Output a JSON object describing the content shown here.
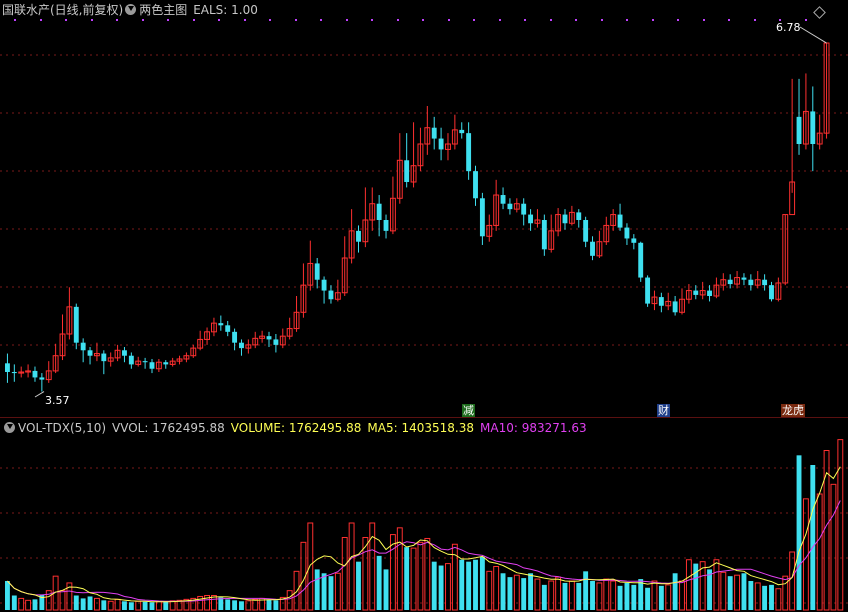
{
  "header": {
    "stock_name": "国联水产(日线,前复权)",
    "indicator_name": "两色主图",
    "eals_label": "EALS: 1.00"
  },
  "price_chart": {
    "high_label": "6.78",
    "low_label": "3.57",
    "tags": [
      {
        "text": "减",
        "bg": "#1d6b1d"
      },
      {
        "text": "财",
        "bg": "#1f3f8a"
      },
      {
        "text": "龙虎",
        "bg": "#7a2a10"
      }
    ]
  },
  "volume_panel": {
    "title": "VOL-TDX(5,10)",
    "vvol": "VVOL: 1762495.88",
    "volume": "VOLUME: 1762495.88",
    "ma5": "MA5: 1403518.38",
    "ma10": "MA10: 983271.63"
  },
  "colors": {
    "up": "#ff3030",
    "down": "#3fe0f0",
    "grid": "#7a1a1a",
    "text": "#c8c8c8",
    "ma5": "#ffff55",
    "ma10": "#e040f0",
    "marker": "#c040ff"
  },
  "chart_data": {
    "type": "candlestick",
    "ylim": [
      3.4,
      6.9
    ],
    "high": 6.78,
    "low": 3.57,
    "candles": [
      [
        3.83,
        3.75,
        3.92,
        3.65
      ],
      [
        3.75,
        3.74,
        3.82,
        3.66
      ],
      [
        3.74,
        3.75,
        3.8,
        3.7
      ],
      [
        3.75,
        3.76,
        3.82,
        3.7
      ],
      [
        3.76,
        3.7,
        3.8,
        3.66
      ],
      [
        3.7,
        3.68,
        3.74,
        3.57
      ],
      [
        3.68,
        3.76,
        3.85,
        3.65
      ],
      [
        3.76,
        3.9,
        4.01,
        3.74
      ],
      [
        3.9,
        4.1,
        4.28,
        3.86
      ],
      [
        4.1,
        4.35,
        4.53,
        4.05
      ],
      [
        4.35,
        4.02,
        4.38,
        3.96
      ],
      [
        4.02,
        3.95,
        4.06,
        3.84
      ],
      [
        3.95,
        3.9,
        3.98,
        3.82
      ],
      [
        3.9,
        3.92,
        4.02,
        3.85
      ],
      [
        3.92,
        3.85,
        3.95,
        3.73
      ],
      [
        3.85,
        3.88,
        3.93,
        3.8
      ],
      [
        3.88,
        3.95,
        4.0,
        3.85
      ],
      [
        3.95,
        3.9,
        3.98,
        3.84
      ],
      [
        3.9,
        3.82,
        3.93,
        3.78
      ],
      [
        3.82,
        3.85,
        3.89,
        3.8
      ],
      [
        3.85,
        3.84,
        3.88,
        3.78
      ],
      [
        3.84,
        3.78,
        3.87,
        3.74
      ],
      [
        3.78,
        3.84,
        3.87,
        3.75
      ],
      [
        3.84,
        3.82,
        3.86,
        3.78
      ],
      [
        3.82,
        3.85,
        3.88,
        3.8
      ],
      [
        3.85,
        3.87,
        3.9,
        3.82
      ],
      [
        3.87,
        3.9,
        3.93,
        3.84
      ],
      [
        3.9,
        3.97,
        4.0,
        3.88
      ],
      [
        3.97,
        4.05,
        4.13,
        3.95
      ],
      [
        4.05,
        4.12,
        4.16,
        4.0
      ],
      [
        4.12,
        4.2,
        4.25,
        4.08
      ],
      [
        4.2,
        4.18,
        4.27,
        4.13
      ],
      [
        4.18,
        4.12,
        4.22,
        4.08
      ],
      [
        4.12,
        4.02,
        4.15,
        3.95
      ],
      [
        4.02,
        3.97,
        4.05,
        3.9
      ],
      [
        3.97,
        4.0,
        4.05,
        3.92
      ],
      [
        4.0,
        4.06,
        4.12,
        3.97
      ],
      [
        4.06,
        4.08,
        4.13,
        4.02
      ],
      [
        4.08,
        4.05,
        4.12,
        3.98
      ],
      [
        4.05,
        4.0,
        4.1,
        3.93
      ],
      [
        4.0,
        4.08,
        4.15,
        3.97
      ],
      [
        4.08,
        4.15,
        4.25,
        4.05
      ],
      [
        4.15,
        4.3,
        4.45,
        4.12
      ],
      [
        4.3,
        4.55,
        4.75,
        4.25
      ],
      [
        4.55,
        4.75,
        4.96,
        4.5
      ],
      [
        4.75,
        4.6,
        4.8,
        4.52
      ],
      [
        4.6,
        4.5,
        4.63,
        4.38
      ],
      [
        4.5,
        4.42,
        4.55,
        4.38
      ],
      [
        4.42,
        4.48,
        4.6,
        4.4
      ],
      [
        4.48,
        4.8,
        5.0,
        4.45
      ],
      [
        4.8,
        5.05,
        5.25,
        4.75
      ],
      [
        5.05,
        4.95,
        5.1,
        4.85
      ],
      [
        4.95,
        5.15,
        5.45,
        4.9
      ],
      [
        5.15,
        5.3,
        5.45,
        5.05
      ],
      [
        5.3,
        5.15,
        5.38,
        5.0
      ],
      [
        5.15,
        5.05,
        5.2,
        4.98
      ],
      [
        5.05,
        5.35,
        5.55,
        5.02
      ],
      [
        5.35,
        5.7,
        5.95,
        5.3
      ],
      [
        5.7,
        5.5,
        5.95,
        5.45
      ],
      [
        5.5,
        5.65,
        6.05,
        5.45
      ],
      [
        5.65,
        5.85,
        6.0,
        5.6
      ],
      [
        5.85,
        6.0,
        6.2,
        5.75
      ],
      [
        6.0,
        5.9,
        6.1,
        5.8
      ],
      [
        5.9,
        5.8,
        6.0,
        5.7
      ],
      [
        5.8,
        5.85,
        5.95,
        5.7
      ],
      [
        5.85,
        5.98,
        6.12,
        5.8
      ],
      [
        5.98,
        5.95,
        6.05,
        5.9
      ],
      [
        5.95,
        5.6,
        6.05,
        5.52
      ],
      [
        5.6,
        5.35,
        5.65,
        5.28
      ],
      [
        5.35,
        5.0,
        5.4,
        4.92
      ],
      [
        5.0,
        5.1,
        5.2,
        4.95
      ],
      [
        5.1,
        5.38,
        5.52,
        5.05
      ],
      [
        5.38,
        5.3,
        5.45,
        5.25
      ],
      [
        5.3,
        5.25,
        5.35,
        5.2
      ],
      [
        5.25,
        5.3,
        5.35,
        5.22
      ],
      [
        5.3,
        5.2,
        5.35,
        5.1
      ],
      [
        5.2,
        5.12,
        5.25,
        5.05
      ],
      [
        5.12,
        5.15,
        5.25,
        5.08
      ],
      [
        5.15,
        4.88,
        5.2,
        4.82
      ],
      [
        4.88,
        5.05,
        5.2,
        4.85
      ],
      [
        5.05,
        5.2,
        5.26,
        5.0
      ],
      [
        5.2,
        5.12,
        5.25,
        5.06
      ],
      [
        5.12,
        5.22,
        5.28,
        5.1
      ],
      [
        5.22,
        5.15,
        5.25,
        5.08
      ],
      [
        5.15,
        4.95,
        5.18,
        4.9
      ],
      [
        4.95,
        4.82,
        5.0,
        4.78
      ],
      [
        4.82,
        4.95,
        5.05,
        4.8
      ],
      [
        4.95,
        5.1,
        5.18,
        4.92
      ],
      [
        5.1,
        5.2,
        5.25,
        5.05
      ],
      [
        5.2,
        5.08,
        5.3,
        5.05
      ],
      [
        5.08,
        4.98,
        5.12,
        4.92
      ],
      [
        4.98,
        4.94,
        5.02,
        4.88
      ],
      [
        4.94,
        4.62,
        4.95,
        4.58
      ],
      [
        4.62,
        4.38,
        4.64,
        4.35
      ],
      [
        4.38,
        4.44,
        4.5,
        4.32
      ],
      [
        4.44,
        4.36,
        4.48,
        4.3
      ],
      [
        4.36,
        4.4,
        4.48,
        4.32
      ],
      [
        4.4,
        4.3,
        4.45,
        4.27
      ],
      [
        4.3,
        4.42,
        4.52,
        4.28
      ],
      [
        4.42,
        4.5,
        4.56,
        4.38
      ],
      [
        4.5,
        4.46,
        4.55,
        4.42
      ],
      [
        4.46,
        4.5,
        4.58,
        4.42
      ],
      [
        4.5,
        4.45,
        4.55,
        4.4
      ],
      [
        4.45,
        4.55,
        4.62,
        4.43
      ],
      [
        4.55,
        4.6,
        4.66,
        4.5
      ],
      [
        4.6,
        4.56,
        4.65,
        4.52
      ],
      [
        4.56,
        4.62,
        4.68,
        4.52
      ],
      [
        4.62,
        4.6,
        4.66,
        4.55
      ],
      [
        4.6,
        4.55,
        4.65,
        4.5
      ],
      [
        4.55,
        4.6,
        4.68,
        4.52
      ],
      [
        4.6,
        4.55,
        4.65,
        4.5
      ],
      [
        4.55,
        4.42,
        4.58,
        4.4
      ],
      [
        4.42,
        4.57,
        4.62,
        4.4
      ],
      [
        4.57,
        5.2,
        5.2,
        4.55
      ],
      [
        5.2,
        5.5,
        6.45,
        5.4
      ],
      [
        6.1,
        5.85,
        6.45,
        5.75
      ],
      [
        5.85,
        6.15,
        6.5,
        5.8
      ],
      [
        6.15,
        5.85,
        6.38,
        5.6
      ],
      [
        5.85,
        5.95,
        6.12,
        5.8
      ],
      [
        5.95,
        6.78,
        6.78,
        5.9
      ]
    ],
    "volume": {
      "ylim": [
        0,
        1800000
      ],
      "values": [
        300000,
        150000,
        120000,
        100000,
        110000,
        160000,
        200000,
        350000,
        200000,
        280000,
        150000,
        120000,
        140000,
        120000,
        100000,
        90000,
        110000,
        90000,
        80000,
        90000,
        85000,
        80000,
        90000,
        85000,
        95000,
        100000,
        110000,
        120000,
        140000,
        150000,
        150000,
        130000,
        110000,
        100000,
        90000,
        95000,
        110000,
        120000,
        110000,
        100000,
        130000,
        200000,
        400000,
        700000,
        900000,
        420000,
        380000,
        350000,
        380000,
        750000,
        900000,
        500000,
        750000,
        900000,
        560000,
        420000,
        780000,
        850000,
        650000,
        640000,
        700000,
        740000,
        500000,
        460000,
        480000,
        680000,
        520000,
        500000,
        520000,
        550000,
        400000,
        450000,
        380000,
        340000,
        360000,
        330000,
        380000,
        320000,
        260000,
        300000,
        340000,
        280000,
        300000,
        280000,
        400000,
        300000,
        280000,
        320000,
        300000,
        250000,
        280000,
        260000,
        320000,
        230000,
        300000,
        250000,
        260000,
        380000,
        300000,
        520000,
        480000,
        500000,
        420000,
        520000,
        390000,
        350000,
        360000,
        380000,
        300000,
        280000,
        250000,
        260000,
        220000,
        350000,
        600000,
        1600000,
        1150000,
        1500000,
        1200000,
        1650000,
        1300000,
        1762496
      ],
      "ma5_label": "MA5",
      "ma10_label": "MA10"
    }
  }
}
